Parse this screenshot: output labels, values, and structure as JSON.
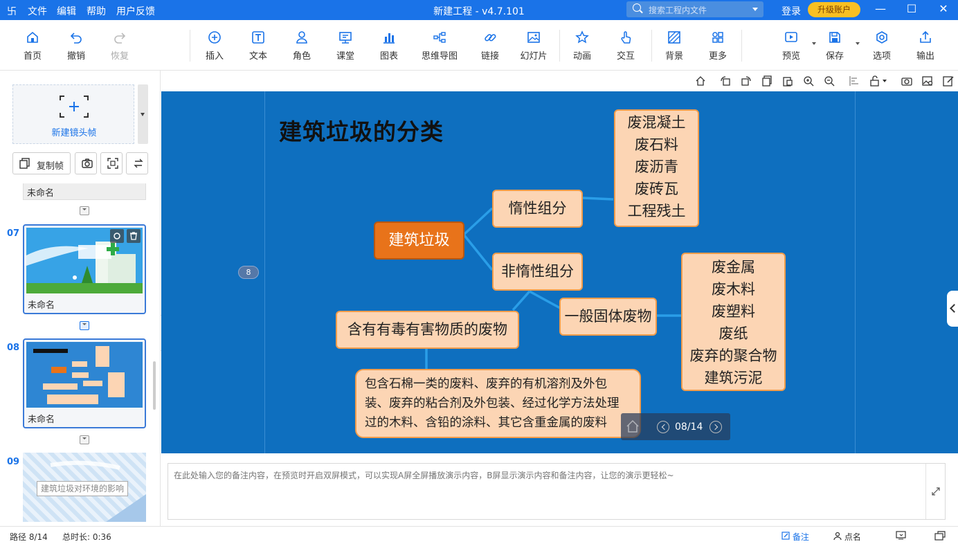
{
  "titlebar": {
    "logo": "卐",
    "menus": [
      "文件",
      "编辑",
      "帮助",
      "用户反馈"
    ],
    "title": "新建工程 - v4.7.101",
    "search_placeholder": "搜索工程内文件",
    "login": "登录",
    "upgrade": "升级账户",
    "minimize": "—",
    "maximize": "☐",
    "close": "✕"
  },
  "toolbar": {
    "items": [
      "首页",
      "撤销",
      "恢复",
      "插入",
      "文本",
      "角色",
      "课堂",
      "图表",
      "思维导图",
      "链接",
      "幻灯片",
      "动画",
      "交互",
      "背景",
      "更多",
      "预览",
      "保存",
      "选项",
      "输出"
    ]
  },
  "sidebar": {
    "new_frame": "新建镜头帧",
    "copy_frame": "复制帧",
    "frames": [
      {
        "num": "",
        "caption": "未命名"
      },
      {
        "num": "07",
        "caption": "未命名"
      },
      {
        "num": "08",
        "caption": "未命名"
      },
      {
        "num": "09",
        "caption": "建筑垃圾对环境的影响"
      }
    ]
  },
  "slide": {
    "title": "建筑垃圾的分类",
    "page_badge": "8",
    "root": "建筑垃圾",
    "inert": "惰性组分",
    "non_inert": "非惰性组分",
    "general_solid": "一般固体废物",
    "toxic": "含有有毒有害物质的废物",
    "inert_items": [
      "废混凝土",
      "废石料",
      "废沥青",
      "废砖瓦",
      "工程残土"
    ],
    "general_items": [
      "废金属",
      "废木料",
      "废塑料",
      "废纸",
      "废弃的聚合物",
      "建筑污泥"
    ],
    "toxic_detail": [
      "包含石棉一类的废料、废弃的有机溶剂及外包",
      "装、废弃的粘合剂及外包装、经过化学方法处理",
      "过的木料、含铅的涂料、其它含重金属的废料"
    ]
  },
  "playbar": {
    "page": "08/14"
  },
  "notes": {
    "placeholder": "在此处输入您的备注内容，在预览时开启双屏模式，可以实现A屏全屏播放演示内容，B屏显示演示内容和备注内容，让您的演示更轻松~"
  },
  "status": {
    "path": "路径 8/14",
    "duration": "总时长: 0:36",
    "notes": "备注",
    "rollcall": "点名"
  },
  "colors": {
    "accent": "#1a73e8",
    "canvas": "#0e6fbf",
    "node_fill": "#fcd5b4",
    "node_border": "#f39c4a",
    "root_fill": "#e8731a"
  }
}
